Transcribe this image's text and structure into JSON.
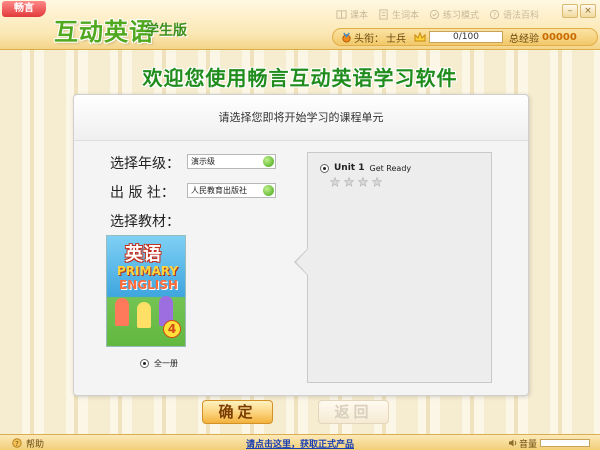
{
  "header": {
    "logo_text": "畅言",
    "title": "互动英语",
    "subtitle": "学生版",
    "menu": [
      {
        "label": "课本",
        "icon": "book-icon"
      },
      {
        "label": "生词本",
        "icon": "notebook-icon"
      },
      {
        "label": "练习模式",
        "icon": "practice-icon"
      },
      {
        "label": "语法百科",
        "icon": "grammar-icon"
      }
    ],
    "window_controls": [
      "minimize",
      "close"
    ]
  },
  "status": {
    "rank_label": "头衔：",
    "rank_value": "士兵",
    "progress_text": "0/100",
    "progress_fraction": 0,
    "xp_label": "总经验",
    "xp_value": "00000"
  },
  "welcome": "欢迎您使用畅言互动英语学习软件",
  "panel": {
    "header": "请选择您即将开始学习的课程单元",
    "grade_label": "选择年级：",
    "grade_value": "演示级",
    "publisher_label": "出 版 社：",
    "publisher_value": "人民教育出版社",
    "textbook_label": "选择教材：",
    "book": {
      "title_cn": "英语",
      "title_en1": "PRIMARY",
      "title_en2": "ENGLISH",
      "grade_number": "4"
    },
    "volume_option": "全一册",
    "unit": {
      "number": "Unit 1",
      "name": "Get Ready",
      "stars_total": 4,
      "stars_earned": 0
    }
  },
  "buttons": {
    "confirm": "确定",
    "back": "返回"
  },
  "footer": {
    "help": "帮助",
    "buy": "请点击这里，获取正式产品",
    "volume_label": "音量"
  },
  "colors": {
    "title_green": "#4fa81e",
    "welcome_green": "#1f8c1c",
    "accent_orange": "#f3b13c",
    "link_blue": "#1a3fb3"
  }
}
